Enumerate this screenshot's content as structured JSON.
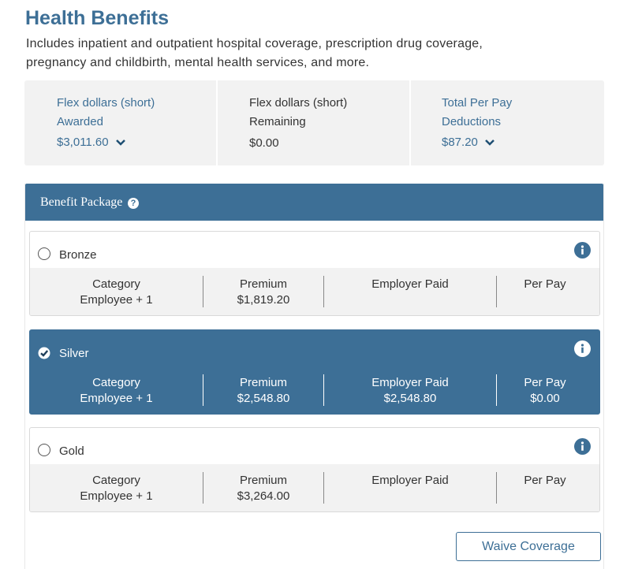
{
  "page": {
    "title": "Health Benefits",
    "description": "Includes inpatient and outpatient hospital coverage, prescription drug coverage, pregnancy and childbirth, mental health services, and more."
  },
  "summary": {
    "awarded": {
      "label_line1": "Flex dollars (short)",
      "label_line2": "Awarded",
      "value": "$3,011.60",
      "icon": "chevron-down-icon"
    },
    "remaining": {
      "label_line1": "Flex dollars (short)",
      "label_line2": "Remaining",
      "value": "$0.00"
    },
    "deductions": {
      "label_line1": "Total Per Pay",
      "label_line2": "Deductions",
      "value": "$87.20",
      "icon": "chevron-down-icon"
    }
  },
  "benefit_package": {
    "title": "Benefit Package",
    "help_icon": "question-circle-icon",
    "column_labels": {
      "category": "Category",
      "premium": "Premium",
      "employer_paid": "Employer Paid",
      "per_pay": "Per Pay"
    },
    "plans": [
      {
        "name": "Bronze",
        "selected": false,
        "category": "Employee + 1",
        "premium": "$1,819.20",
        "employer_paid": "",
        "per_pay": ""
      },
      {
        "name": "Silver",
        "selected": true,
        "category": "Employee + 1",
        "premium": "$2,548.80",
        "employer_paid": "$2,548.80",
        "per_pay": "$0.00"
      },
      {
        "name": "Gold",
        "selected": false,
        "category": "Employee + 1",
        "premium": "$3,264.00",
        "employer_paid": "",
        "per_pay": ""
      }
    ],
    "info_icon": "info-icon",
    "waive_label": "Waive Coverage"
  },
  "colors": {
    "primary": "#3d6f96",
    "panel_bg": "#f2f2f2",
    "text": "#333333"
  }
}
